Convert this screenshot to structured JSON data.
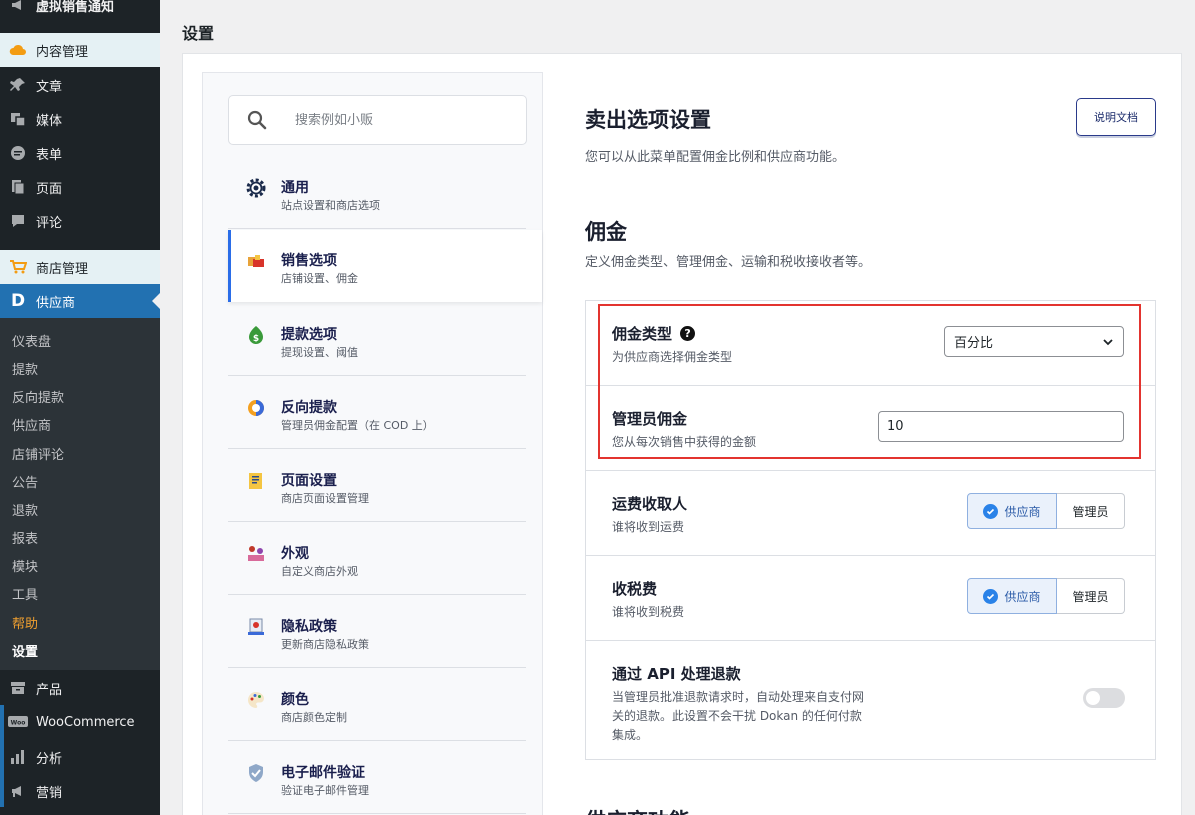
{
  "wp_menu": {
    "items": [
      {
        "label": "虚拟销售通知",
        "icon": "megaphone-icon"
      },
      {
        "label": "内容管理",
        "icon": "cloud-icon"
      },
      {
        "label": "文章",
        "icon": "pin-icon"
      },
      {
        "label": "媒体",
        "icon": "media-icon"
      },
      {
        "label": "表单",
        "icon": "form-icon"
      },
      {
        "label": "页面",
        "icon": "page-icon"
      },
      {
        "label": "评论",
        "icon": "comment-icon"
      },
      {
        "label": "商店管理",
        "icon": "cart-icon"
      },
      {
        "label": "供应商",
        "icon": "dokan-icon"
      },
      {
        "label": "产品",
        "icon": "archive-icon"
      },
      {
        "label": "WooCommerce",
        "icon": "woo-icon"
      },
      {
        "label": "分析",
        "icon": "chart-icon"
      },
      {
        "label": "营销",
        "icon": "megaphone-icon"
      }
    ],
    "submenu": [
      "仪表盘",
      "提款",
      "反向提款",
      "供应商",
      "店铺评论",
      "公告",
      "退款",
      "报表",
      "模块",
      "工具",
      "帮助",
      "设置"
    ]
  },
  "page_title": "设置",
  "settings_nav": {
    "search_placeholder": "搜索例如小贩",
    "items": [
      {
        "title": "通用",
        "desc": "站点设置和商店选项",
        "icon": "gear-icon"
      },
      {
        "title": "销售选项",
        "desc": "店铺设置、佣金",
        "icon": "store-icon"
      },
      {
        "title": "提款选项",
        "desc": "提现设置、阈值",
        "icon": "money-icon"
      },
      {
        "title": "反向提款",
        "desc": "管理员佣金配置（在 COD 上）",
        "icon": "reverse-icon"
      },
      {
        "title": "页面设置",
        "desc": "商店页面设置管理",
        "icon": "page-settings-icon"
      },
      {
        "title": "外观",
        "desc": "自定义商店外观",
        "icon": "appearance-icon"
      },
      {
        "title": "隐私政策",
        "desc": "更新商店隐私政策",
        "icon": "privacy-icon"
      },
      {
        "title": "颜色",
        "desc": "商店颜色定制",
        "icon": "palette-icon"
      },
      {
        "title": "电子邮件验证",
        "desc": "验证电子邮件管理",
        "icon": "shield-icon"
      }
    ]
  },
  "content": {
    "title": "卖出选项设置",
    "subtitle": "您可以从此菜单配置佣金比例和供应商功能。",
    "doc_button": "说明文档",
    "section_title": "佣金",
    "section_subtitle": "定义佣金类型、管理佣金、运输和税收接收者等。",
    "rows": {
      "commission_type": {
        "label": "佣金类型",
        "desc": "为供应商选择佣金类型",
        "value": "百分比"
      },
      "admin_commission": {
        "label": "管理员佣金",
        "desc": "您从每次销售中获得的金额",
        "value": "10"
      },
      "shipping_recipient": {
        "label": "运费收取人",
        "desc": "谁将收到运费",
        "options": [
          "供应商",
          "管理员"
        ],
        "selected": "供应商"
      },
      "tax_recipient": {
        "label": "收税费",
        "desc": "谁将收到税费",
        "options": [
          "供应商",
          "管理员"
        ],
        "selected": "供应商"
      },
      "api_refund": {
        "label": "通过 API 处理退款",
        "desc": "当管理员批准退款请求时，自动处理来自支付网关的退款。此设置不会干扰 Dokan 的任何付款集成。",
        "enabled": false
      }
    },
    "next_section_title": "供应商功能"
  },
  "colors": {
    "accent": "#2a6de8",
    "highlight_box": "#e3342f",
    "wp_current": "#2271b1"
  }
}
